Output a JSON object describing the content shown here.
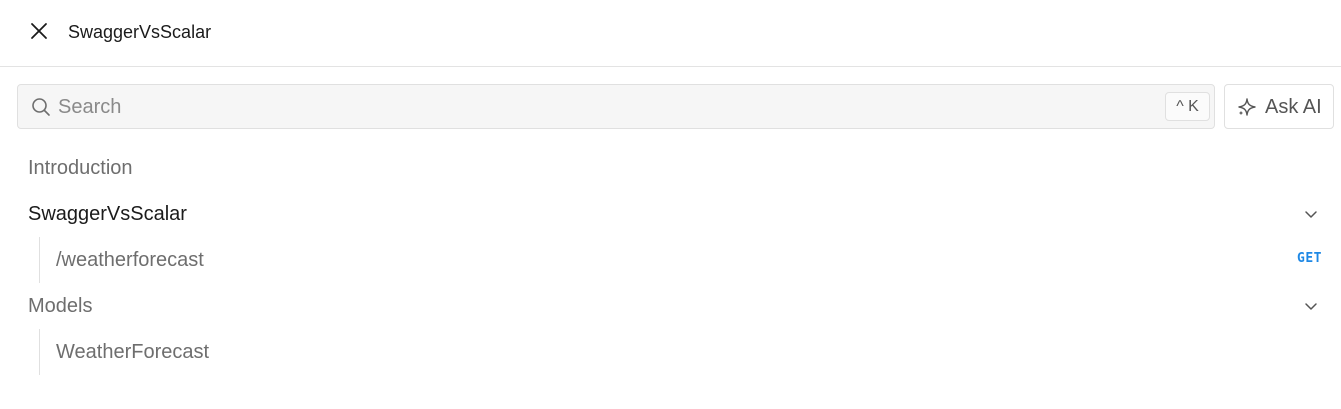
{
  "header": {
    "title": "SwaggerVsScalar",
    "close_icon": "close-icon"
  },
  "search": {
    "placeholder": "Search",
    "value": "",
    "shortcut": "^ K"
  },
  "ask_ai": {
    "label": "Ask AI",
    "icon": "sparkle-icon"
  },
  "nav": {
    "introduction": "Introduction",
    "group1": {
      "label": "SwaggerVsScalar",
      "expanded": true,
      "items": [
        {
          "label": "/weatherforecast",
          "method": "GET"
        }
      ]
    },
    "group2": {
      "label": "Models",
      "expanded": true,
      "items": [
        {
          "label": "WeatherForecast"
        }
      ]
    }
  },
  "colors": {
    "get_method": "#1e88e5",
    "border": "#e0e0e0",
    "search_bg": "#f6f6f6"
  }
}
